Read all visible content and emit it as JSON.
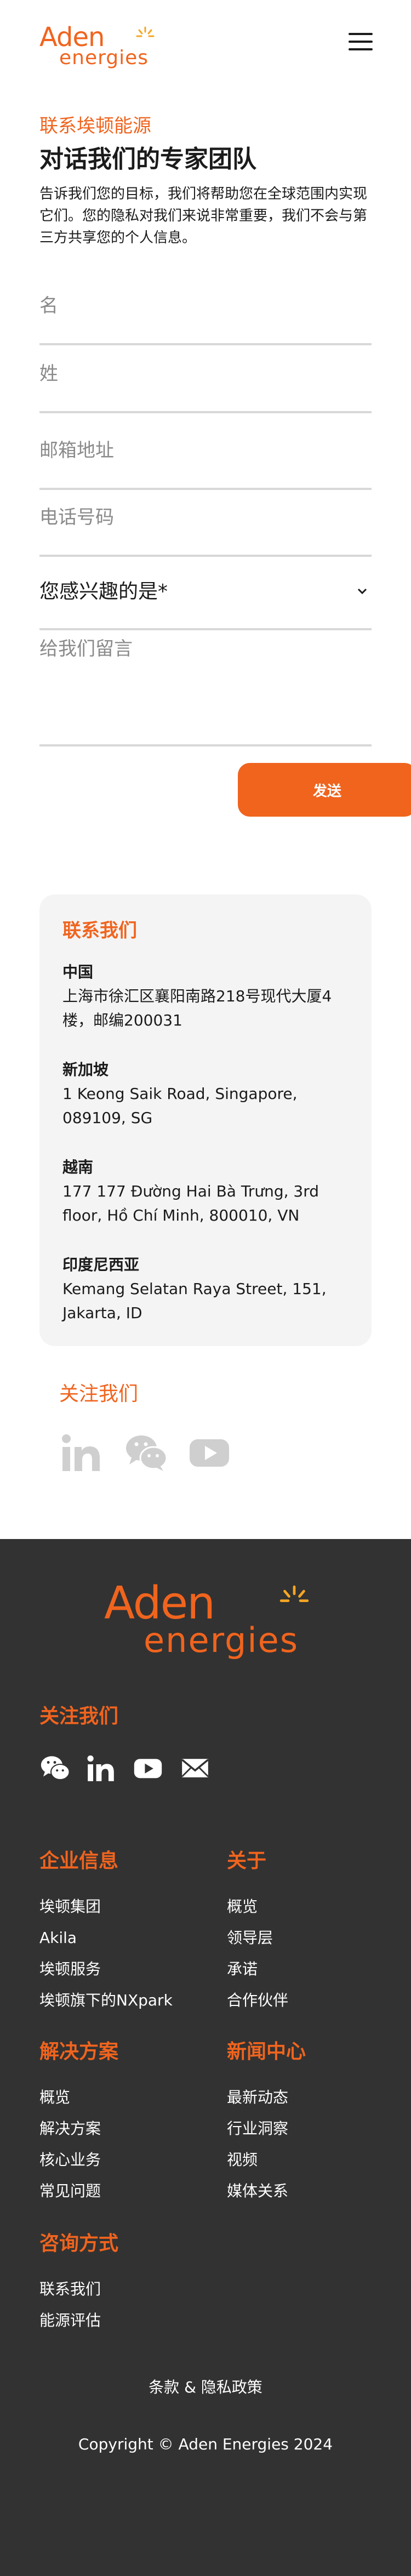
{
  "brand": {
    "logo_word": "Aden",
    "logo_sub": "energies",
    "accent": "#f0641e",
    "footer_bg": "#323232"
  },
  "header": {
    "menu_icon": "hamburger-icon"
  },
  "intro": {
    "kicker": "联系埃顿能源",
    "heading": "对话我们的专家团队",
    "description": "告诉我们您的目标，我们将帮助您在全球范围内实现它们。您的隐私对我们来说非常重要，我们不会与第三方共享您的个人信息。"
  },
  "form": {
    "first_name_placeholder": "名",
    "last_name_placeholder": "姓",
    "email_placeholder": "邮箱地址",
    "phone_placeholder": "电话号码",
    "interest_label": "您感兴趣的是*",
    "message_placeholder": "给我们留言",
    "send_label": "发送"
  },
  "contact": {
    "title": "联系我们",
    "offices": [
      {
        "name": "中国",
        "address": "上海市徐汇区襄阳南路218号现代大厦4楼，邮编200031"
      },
      {
        "name": "新加坡",
        "address": "1 Keong Saik Road, Singapore, 089109, SG"
      },
      {
        "name": "越南",
        "address": "177 177 Đường Hai Bà Trưng, 3rd floor, Hồ Chí Minh, 800010, VN"
      },
      {
        "name": "印度尼西亚",
        "address": "Kemang Selatan Raya Street, 151, Jakarta, ID"
      }
    ]
  },
  "follow": {
    "title": "关注我们",
    "icons": [
      "linkedin-icon",
      "wechat-icon",
      "youtube-icon"
    ]
  },
  "footer": {
    "follow_title": "关注我们",
    "social_icons": [
      "wechat-icon",
      "linkedin-icon",
      "youtube-icon",
      "mail-icon"
    ],
    "columns": [
      {
        "title": "企业信息",
        "links": [
          "埃顿集团",
          "Akila",
          "埃顿服务",
          "埃顿旗下的NXpark"
        ]
      },
      {
        "title": "关于",
        "links": [
          "概览",
          "领导层",
          "承诺",
          "合作伙伴"
        ]
      },
      {
        "title": "解决方案",
        "links": [
          "概览",
          "解决方案",
          "核心业务",
          "常见问题"
        ]
      },
      {
        "title": "新闻中心",
        "links": [
          "最新动态",
          "行业洞察",
          "视频",
          "媒体关系"
        ]
      },
      {
        "title": "咨询方式",
        "links": [
          "联系我们",
          "能源评估"
        ]
      }
    ],
    "terms": "条款 & 隐私政策",
    "copyright": "Copyright © Aden Energies 2024"
  }
}
